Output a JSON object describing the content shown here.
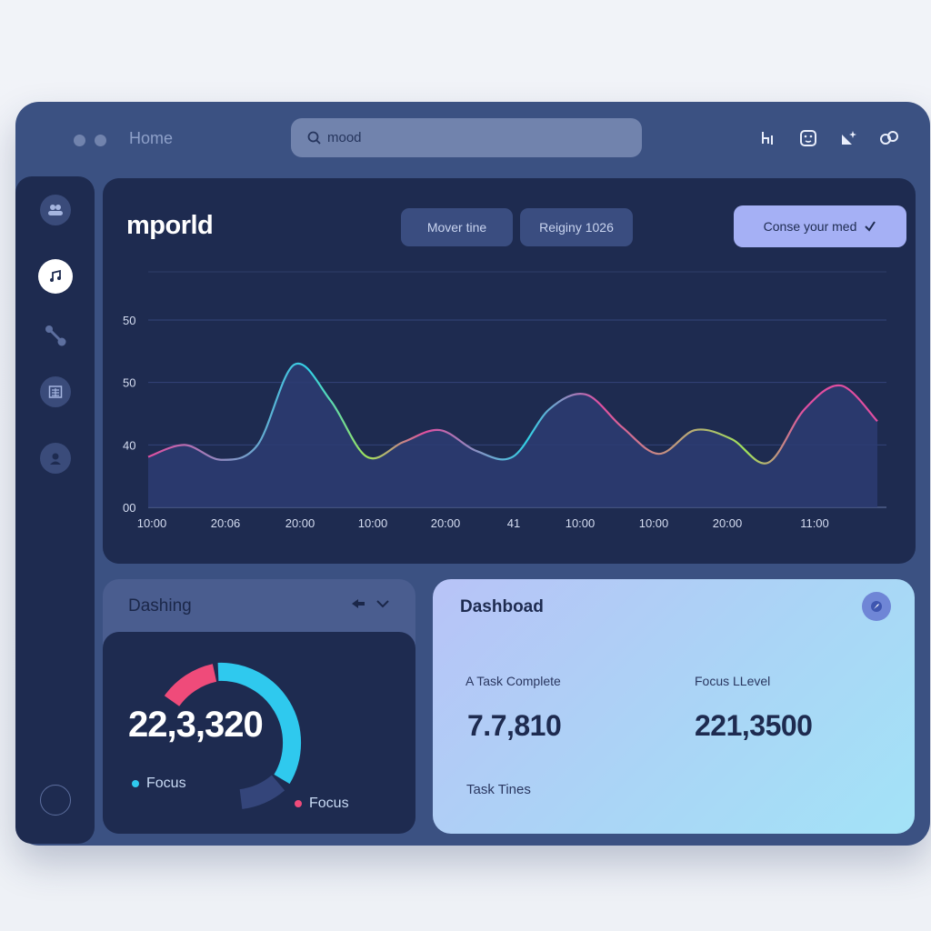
{
  "window": {
    "nav_label": "Home",
    "search": {
      "value": "mood",
      "placeholder": ""
    },
    "toolbar_icons": [
      "chart-icon",
      "face-icon",
      "sparkle-icon",
      "link-icon"
    ]
  },
  "sidebar": {
    "items": [
      "people-icon",
      "music-icon",
      "share-icon",
      "calendar-icon",
      "profile-icon",
      "circle-icon"
    ],
    "active": "music-icon"
  },
  "main": {
    "brand": "mporld",
    "pill_1": "Mover tine",
    "pill_2": "Reiginy 1026",
    "cta": "Conse your med"
  },
  "chart_data": {
    "type": "area",
    "y_ticks": [
      "50",
      "50",
      "40",
      "00"
    ],
    "x_ticks": [
      "10:00",
      "20:06",
      "20:00",
      "10:00",
      "20:00",
      "41",
      "10:00",
      "10:00",
      "20:00",
      "11:00"
    ],
    "ylim": [
      0,
      60
    ],
    "x": [
      0,
      0.5,
      1,
      1.5,
      2,
      2.5,
      3,
      3.5,
      4,
      4.5,
      5,
      5.5,
      6,
      6.5,
      7,
      7.5,
      8,
      8.5,
      9,
      9.5,
      10
    ],
    "values": [
      17,
      21,
      16,
      21,
      48,
      36,
      17,
      22,
      26,
      19,
      17,
      33,
      38,
      27,
      18,
      26,
      23,
      15,
      33,
      41,
      29
    ],
    "grid": true,
    "colors": [
      "#e04ea0",
      "#31d2e6",
      "#9fe35a"
    ]
  },
  "dashing": {
    "title": "Dashing",
    "value": "22,3,320",
    "legend_1": "Focus",
    "legend_2": "Focus",
    "colors": {
      "focus_1": "#2fc9ee",
      "focus_2": "#ef4b7a"
    }
  },
  "dashboard": {
    "title": "Dashboad",
    "stats": [
      {
        "label": "A Task Complete",
        "value": "7.7,810"
      },
      {
        "label": "Focus LLevel",
        "value": "221,3500"
      }
    ],
    "footer_label": "Task Tines"
  }
}
